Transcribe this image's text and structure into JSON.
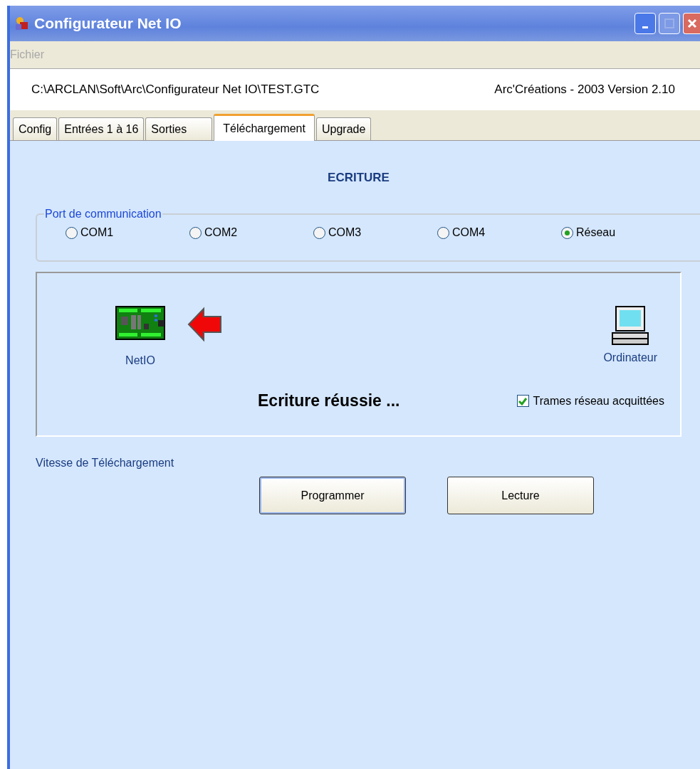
{
  "window": {
    "title": "Configurateur Net IO"
  },
  "menu": [
    {
      "label": "Fichier",
      "disabled": true
    }
  ],
  "info": {
    "path": "C:\\ARCLAN\\Soft\\Arc\\Configurateur Net IO\\TEST.GTC",
    "version": "Arc'Créations - 2003  Version 2.10"
  },
  "tabs": [
    {
      "label": "Config",
      "selected": false
    },
    {
      "label": "Entrées 1 à 16",
      "selected": false
    },
    {
      "label": "Sorties",
      "selected": false
    },
    {
      "label": "Téléchargement",
      "selected": true
    },
    {
      "label": "Upgrade",
      "selected": false
    }
  ],
  "heading": "ECRITURE",
  "port_group": {
    "label": "Port de communication",
    "options": [
      {
        "label": "COM1",
        "selected": false
      },
      {
        "label": "COM2",
        "selected": false
      },
      {
        "label": "COM3",
        "selected": false
      },
      {
        "label": "COM4",
        "selected": false
      },
      {
        "label": "Réseau",
        "selected": true
      }
    ]
  },
  "transfer": {
    "device_label": "NetIO",
    "computer_label": "Ordinateur",
    "status": "Ecriture réussie ...",
    "ack": {
      "label": "Trames réseau acquittées",
      "checked": true
    }
  },
  "speed_label": "Vitesse de Téléchargement",
  "buttons": [
    "Programmer",
    "Lecture"
  ]
}
